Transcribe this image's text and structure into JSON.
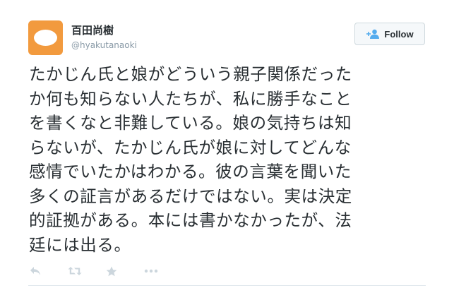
{
  "user": {
    "name": "百田尚樹",
    "handle": "@hyakutanaoki",
    "avatar_color": "#f29a3e"
  },
  "follow_button": {
    "label": "Follow",
    "icon": "follow-person-plus-icon"
  },
  "tweet": {
    "text": "たかじん氏と娘がどういう親子関係だった\nか何も知らない人たちが、私に勝手なこと\nを書くなと非難している。娘の気持ちは知\nらないが、たかじん氏が娘に対してどんな\n感情でいたかはわかる。彼の言葉を聞いた\n多くの証言があるだけではない。実は決定\n的証拠がある。本には書かなかったが、法\n廷には出る。"
  },
  "actions": [
    {
      "icon": "reply-icon"
    },
    {
      "icon": "retweet-icon"
    },
    {
      "icon": "favorite-star-icon"
    },
    {
      "icon": "more-dots-icon"
    }
  ],
  "colors": {
    "text": "#292f33",
    "secondary": "#8899a6",
    "action_icons": "#ccd6dd"
  }
}
